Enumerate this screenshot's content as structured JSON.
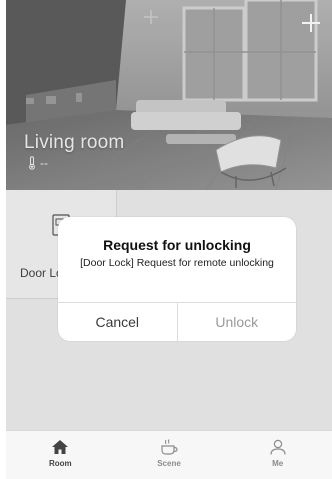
{
  "header": {
    "room_name": "Living room",
    "temperature": "--"
  },
  "devices": [
    {
      "name": "Door Lock",
      "icon": "door-lock-icon"
    }
  ],
  "dialog": {
    "title": "Request for unlocking",
    "message": "[Door Lock] Request for remote unlocking",
    "cancel_label": "Cancel",
    "confirm_label": "Unlock"
  },
  "tabbar": {
    "items": [
      {
        "label": "Room",
        "icon": "home-icon",
        "active": true
      },
      {
        "label": "Scene",
        "icon": "scene-cup-icon",
        "active": false
      },
      {
        "label": "Me",
        "icon": "person-icon",
        "active": false
      }
    ]
  },
  "colors": {
    "background": "#ececec",
    "dialog_bg": "#ffffff",
    "tab_active": "#444444",
    "tab_inactive": "#8c8c8c"
  }
}
